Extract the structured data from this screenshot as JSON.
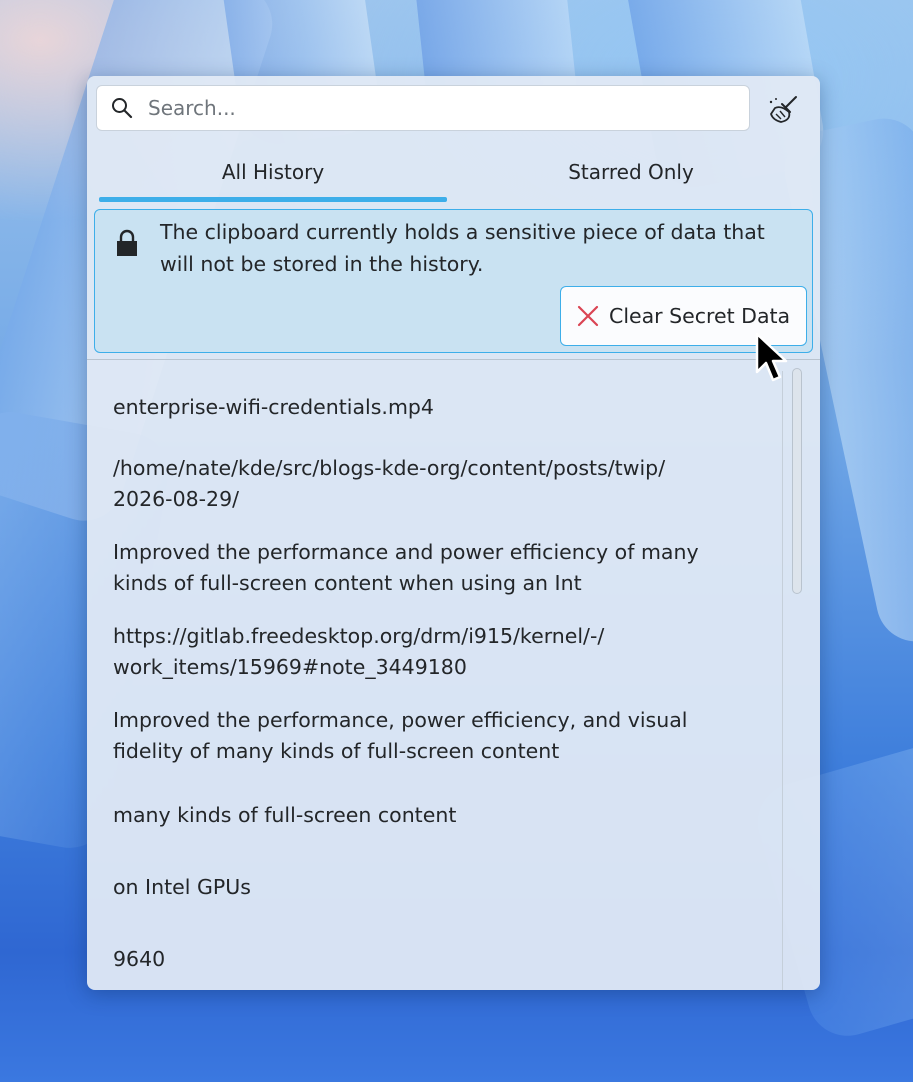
{
  "search": {
    "placeholder": "Search..."
  },
  "tabs": [
    {
      "label": "All History",
      "selected": true
    },
    {
      "label": "Starred Only",
      "selected": false
    }
  ],
  "message": {
    "text": "The clipboard currently holds a sensitive piece of data that will not be stored in the history.",
    "button_label": "Clear Secret Data"
  },
  "history": [
    "enterprise-wifi-credentials.mp4",
    "/home/nate/kde/src/blogs-kde-org/content/posts/twip/\n2026-08-29/",
    "Improved the performance and power efficiency of many\nkinds of full-screen content when using an Int",
    "https://gitlab.freedesktop.org/drm/i915/kernel/-/\nwork_items/15969#note_3449180",
    "Improved the performance, power efficiency, and visual\nfidelity of many kinds of full-screen content",
    "many kinds of full-screen content",
    "on Intel GPUs",
    "9640"
  ],
  "colors": {
    "accent": "#3daee9",
    "close_red": "#da4453",
    "text": "#232629"
  }
}
